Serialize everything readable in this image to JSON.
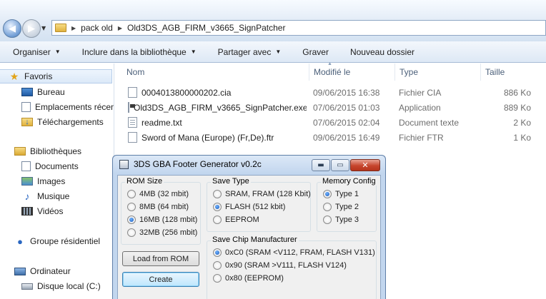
{
  "explorer": {
    "breadcrumb": [
      "pack old",
      "Old3DS_AGB_FIRM_v3665_SignPatcher"
    ],
    "toolbar": [
      {
        "label": "Organiser",
        "dropdown": true
      },
      {
        "label": "Inclure dans la bibliothèque",
        "dropdown": true
      },
      {
        "label": "Partager avec",
        "dropdown": true
      },
      {
        "label": "Graver",
        "dropdown": false
      },
      {
        "label": "Nouveau dossier",
        "dropdown": false
      }
    ],
    "sidebar": [
      {
        "label": "Favoris",
        "icon": "star-icon",
        "selected": true
      },
      {
        "label": "Bureau",
        "icon": "desktop-icon"
      },
      {
        "label": "Emplacements récen",
        "icon": "recent-places-icon"
      },
      {
        "label": "Téléchargements",
        "icon": "downloads-icon"
      },
      {
        "label": "Bibliothèques",
        "icon": "libraries-icon"
      },
      {
        "label": "Documents",
        "icon": "documents-icon"
      },
      {
        "label": "Images",
        "icon": "pictures-icon"
      },
      {
        "label": "Musique",
        "icon": "music-icon"
      },
      {
        "label": "Vidéos",
        "icon": "videos-icon"
      },
      {
        "label": "Groupe résidentiel",
        "icon": "homegroup-icon"
      },
      {
        "label": "Ordinateur",
        "icon": "computer-icon"
      },
      {
        "label": "Disque local (C:)",
        "icon": "disk-icon"
      }
    ],
    "columns": {
      "name": "Nom",
      "modified": "Modifié le",
      "type": "Type",
      "size": "Taille"
    },
    "files": [
      {
        "name": "0004013800000202.cia",
        "modified": "09/06/2015 16:38",
        "type": "Fichier CIA",
        "size": "886 Ko",
        "icon": "file-icon"
      },
      {
        "name": "Old3DS_AGB_FIRM_v3665_SignPatcher.exe",
        "modified": "07/06/2015 01:03",
        "type": "Application",
        "size": "889 Ko",
        "icon": "exe-icon"
      },
      {
        "name": "readme.txt",
        "modified": "07/06/2015 02:04",
        "type": "Document texte",
        "size": "2 Ko",
        "icon": "text-file-icon"
      },
      {
        "name": "Sword of Mana (Europe) (Fr,De).ftr",
        "modified": "09/06/2015 16:49",
        "type": "Fichier FTR",
        "size": "1 Ko",
        "icon": "file-icon"
      }
    ]
  },
  "dialog": {
    "title": "3DS GBA Footer Generator v0.2c",
    "rom_size": {
      "label": "ROM Size",
      "options": [
        "4MB (32 mbit)",
        "8MB (64 mbit)",
        "16MB (128 mbit)",
        "32MB (256 mbit)"
      ],
      "selected": 2
    },
    "save_type": {
      "label": "Save Type",
      "options": [
        "SRAM, FRAM (128 Kbit)",
        "FLASH (512 kbit)",
        "EEPROM"
      ],
      "selected": 1
    },
    "memory_config": {
      "label": "Memory Config",
      "options": [
        "Type 1",
        "Type 2",
        "Type 3"
      ],
      "selected": 0
    },
    "save_chip": {
      "label": "Save Chip Manufacturer",
      "options": [
        "0xC0 (SRAM <V112, FRAM, FLASH V131)",
        "0x90 (SRAM >V111, FLASH V124)",
        "0x80 (EEPROM)"
      ],
      "selected": 0
    },
    "load_button": "Load from ROM",
    "create_button": "Create"
  }
}
